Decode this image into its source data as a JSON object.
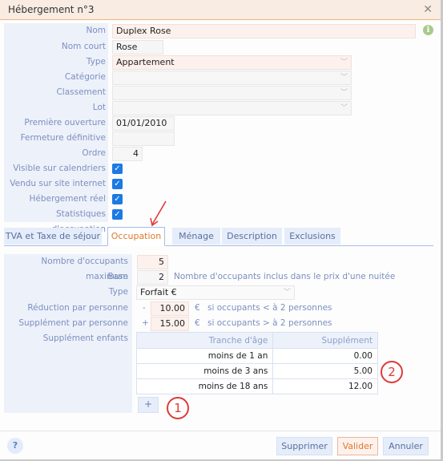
{
  "window": {
    "title": "Hébergement n°3",
    "close_icon": "close-icon"
  },
  "form": {
    "nom": {
      "label": "Nom",
      "value": "Duplex Rose"
    },
    "nom_court": {
      "label": "Nom court",
      "value": "Rose"
    },
    "type": {
      "label": "Type",
      "value": "Appartement"
    },
    "categorie": {
      "label": "Catégorie",
      "value": ""
    },
    "classement": {
      "label": "Classement",
      "value": ""
    },
    "lot": {
      "label": "Lot",
      "value": ""
    },
    "premiere_ouverture": {
      "label": "Première ouverture",
      "value": "01/01/2010"
    },
    "fermeture_definitive": {
      "label": "Fermeture définitive",
      "value": ""
    },
    "ordre": {
      "label": "Ordre",
      "value": "4"
    },
    "visible_calendriers": {
      "label": "Visible sur calendriers",
      "checked": true
    },
    "vendu_site": {
      "label": "Vendu sur site internet",
      "checked": true
    },
    "hebergement_reel": {
      "label": "Hébergement réel",
      "checked": true
    },
    "stats_occupation": {
      "label": "Statistiques d'occupation",
      "checked": true
    },
    "info_icon": "info-icon"
  },
  "tabs": [
    {
      "label": "TVA et Taxe de séjour",
      "active": false
    },
    {
      "label": "Occupation",
      "active": true
    },
    {
      "label": "Ménage",
      "active": false
    },
    {
      "label": "Description",
      "active": false
    },
    {
      "label": "Exclusions",
      "active": false
    }
  ],
  "occupation": {
    "max": {
      "label": "Nombre d'occupants maximum",
      "value": "5"
    },
    "base": {
      "label": "Base",
      "value": "2",
      "hint": "Nombre d'occupants inclus dans le prix d'une nuitée"
    },
    "type": {
      "label": "Type",
      "value": "Forfait €"
    },
    "reduction": {
      "label": "Réduction par personne",
      "sign": "-",
      "value": "10.00",
      "unit": "€",
      "hint": "si occupants < à 2 personnes"
    },
    "supplement": {
      "label": "Supplément par personne",
      "sign": "+",
      "value": "15.00",
      "unit": "€",
      "hint": "si occupants > à 2 personnes"
    },
    "enfants": {
      "label": "Supplément enfants",
      "columns": [
        "Tranche d'âge",
        "Supplément"
      ],
      "rows": [
        [
          "moins de 1 an",
          "0.00"
        ],
        [
          "moins de 3 ans",
          "5.00"
        ],
        [
          "moins de 18 ans",
          "12.00"
        ]
      ],
      "add_label": "+"
    }
  },
  "annotations": {
    "callout1": "1",
    "callout2": "2"
  },
  "footer": {
    "help_label": "?",
    "delete_label": "Supprimer",
    "validate_label": "Valider",
    "cancel_label": "Annuler"
  }
}
